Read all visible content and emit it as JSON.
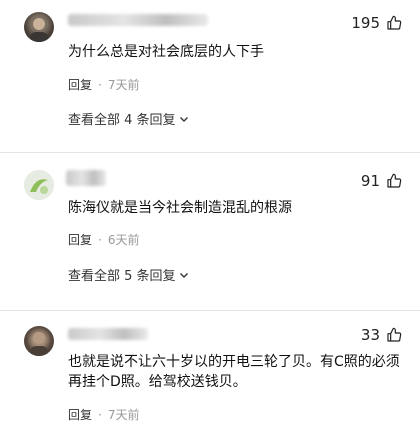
{
  "comments": [
    {
      "likes": "195",
      "text": "为什么总是对社会底层的人下手",
      "reply_label": "回复",
      "time": "7天前",
      "view_more": "查看全部 4 条回复"
    },
    {
      "likes": "91",
      "text": "陈海仪就是当今社会制造混乱的根源",
      "reply_label": "回复",
      "time": "6天前",
      "view_more": "查看全部 5 条回复"
    },
    {
      "likes": "33",
      "text_line1": "也就是说不让六十岁以的开电三轮了贝。有C照的必须",
      "text_line2": "再挂个D照。给驾校送钱贝。",
      "reply_label": "回复",
      "time": "7天前"
    }
  ],
  "separator": "·",
  "icons": {
    "like": "thumbs-up-icon",
    "expand": "chevron-down-icon"
  }
}
